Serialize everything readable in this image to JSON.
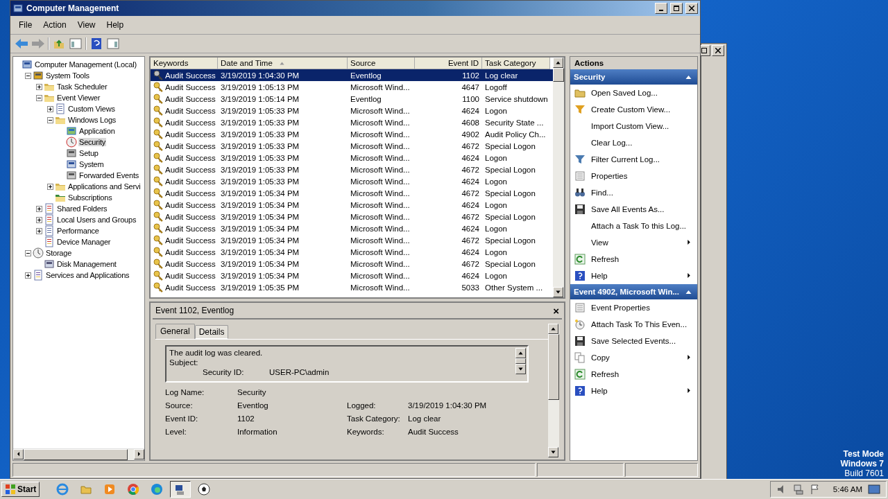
{
  "window": {
    "title": "Computer Management"
  },
  "menu": [
    "File",
    "Action",
    "View",
    "Help"
  ],
  "tree": [
    {
      "label": "Computer Management (Local)",
      "selected": false,
      "children": [
        {
          "label": "System Tools",
          "expanded": true,
          "selected": false,
          "children": [
            {
              "label": "Task Scheduler",
              "expanded": false,
              "selected": false
            },
            {
              "label": "Event Viewer",
              "expanded": true,
              "selected": false,
              "children": [
                {
                  "label": "Custom Views",
                  "expanded": false,
                  "selected": false
                },
                {
                  "label": "Windows Logs",
                  "expanded": true,
                  "selected": false,
                  "children": [
                    {
                      "label": "Application",
                      "selected": false
                    },
                    {
                      "label": "Security",
                      "selected": true
                    },
                    {
                      "label": "Setup",
                      "selected": false
                    },
                    {
                      "label": "System",
                      "selected": false
                    },
                    {
                      "label": "Forwarded Events",
                      "selected": false
                    }
                  ]
                },
                {
                  "label": "Applications and Servi",
                  "expanded": false,
                  "selected": false
                },
                {
                  "label": "Subscriptions",
                  "selected": false
                }
              ]
            },
            {
              "label": "Shared Folders",
              "expanded": false,
              "selected": false
            },
            {
              "label": "Local Users and Groups",
              "expanded": false,
              "selected": false
            },
            {
              "label": "Performance",
              "expanded": false,
              "selected": false
            },
            {
              "label": "Device Manager",
              "selected": false
            }
          ]
        },
        {
          "label": "Storage",
          "expanded": true,
          "selected": false,
          "children": [
            {
              "label": "Disk Management",
              "selected": false
            }
          ]
        },
        {
          "label": "Services and Applications",
          "expanded": false,
          "selected": false
        }
      ]
    }
  ],
  "event_table": {
    "columns": [
      {
        "label": "Keywords",
        "sorted": false
      },
      {
        "label": "Date and Time",
        "sorted": true
      },
      {
        "label": "Source",
        "sorted": false
      },
      {
        "label": "Event ID",
        "sorted": false
      },
      {
        "label": "Task Category",
        "sorted": false
      }
    ],
    "rows": [
      {
        "keywords": "Audit Success",
        "date": "3/19/2019 1:04:30 PM",
        "source": "Eventlog",
        "event_id": "1102",
        "task_category": "Log clear",
        "selected": true
      },
      {
        "keywords": "Audit Success",
        "date": "3/19/2019 1:05:13 PM",
        "source": "Microsoft Wind...",
        "event_id": "4647",
        "task_category": "Logoff",
        "selected": false
      },
      {
        "keywords": "Audit Success",
        "date": "3/19/2019 1:05:14 PM",
        "source": "Eventlog",
        "event_id": "1100",
        "task_category": "Service shutdown",
        "selected": false
      },
      {
        "keywords": "Audit Success",
        "date": "3/19/2019 1:05:33 PM",
        "source": "Microsoft Wind...",
        "event_id": "4624",
        "task_category": "Logon",
        "selected": false
      },
      {
        "keywords": "Audit Success",
        "date": "3/19/2019 1:05:33 PM",
        "source": "Microsoft Wind...",
        "event_id": "4608",
        "task_category": "Security State ...",
        "selected": false
      },
      {
        "keywords": "Audit Success",
        "date": "3/19/2019 1:05:33 PM",
        "source": "Microsoft Wind...",
        "event_id": "4902",
        "task_category": "Audit Policy Ch...",
        "selected": false
      },
      {
        "keywords": "Audit Success",
        "date": "3/19/2019 1:05:33 PM",
        "source": "Microsoft Wind...",
        "event_id": "4672",
        "task_category": "Special Logon",
        "selected": false
      },
      {
        "keywords": "Audit Success",
        "date": "3/19/2019 1:05:33 PM",
        "source": "Microsoft Wind...",
        "event_id": "4624",
        "task_category": "Logon",
        "selected": false
      },
      {
        "keywords": "Audit Success",
        "date": "3/19/2019 1:05:33 PM",
        "source": "Microsoft Wind...",
        "event_id": "4672",
        "task_category": "Special Logon",
        "selected": false
      },
      {
        "keywords": "Audit Success",
        "date": "3/19/2019 1:05:33 PM",
        "source": "Microsoft Wind...",
        "event_id": "4624",
        "task_category": "Logon",
        "selected": false
      },
      {
        "keywords": "Audit Success",
        "date": "3/19/2019 1:05:34 PM",
        "source": "Microsoft Wind...",
        "event_id": "4672",
        "task_category": "Special Logon",
        "selected": false
      },
      {
        "keywords": "Audit Success",
        "date": "3/19/2019 1:05:34 PM",
        "source": "Microsoft Wind...",
        "event_id": "4624",
        "task_category": "Logon",
        "selected": false
      },
      {
        "keywords": "Audit Success",
        "date": "3/19/2019 1:05:34 PM",
        "source": "Microsoft Wind...",
        "event_id": "4672",
        "task_category": "Special Logon",
        "selected": false
      },
      {
        "keywords": "Audit Success",
        "date": "3/19/2019 1:05:34 PM",
        "source": "Microsoft Wind...",
        "event_id": "4624",
        "task_category": "Logon",
        "selected": false
      },
      {
        "keywords": "Audit Success",
        "date": "3/19/2019 1:05:34 PM",
        "source": "Microsoft Wind...",
        "event_id": "4672",
        "task_category": "Special Logon",
        "selected": false
      },
      {
        "keywords": "Audit Success",
        "date": "3/19/2019 1:05:34 PM",
        "source": "Microsoft Wind...",
        "event_id": "4624",
        "task_category": "Logon",
        "selected": false
      },
      {
        "keywords": "Audit Success",
        "date": "3/19/2019 1:05:34 PM",
        "source": "Microsoft Wind...",
        "event_id": "4672",
        "task_category": "Special Logon",
        "selected": false
      },
      {
        "keywords": "Audit Success",
        "date": "3/19/2019 1:05:34 PM",
        "source": "Microsoft Wind...",
        "event_id": "4624",
        "task_category": "Logon",
        "selected": false
      },
      {
        "keywords": "Audit Success",
        "date": "3/19/2019 1:05:35 PM",
        "source": "Microsoft Wind...",
        "event_id": "5033",
        "task_category": "Other System ...",
        "selected": false
      }
    ]
  },
  "event_detail": {
    "title": "Event 1102, Eventlog",
    "close": "×",
    "tabs": [
      {
        "label": "General",
        "selected": true
      },
      {
        "label": "Details",
        "selected": false
      }
    ],
    "message": [
      "The audit log was cleared.",
      "Subject:"
    ],
    "message_field": {
      "label": "Security ID:",
      "value": "USER-PC\\admin"
    },
    "fields": [
      {
        "label": "Log Name:",
        "value": "Security"
      },
      {
        "label": "Source:",
        "value": "Eventlog",
        "label_2": "Logged:",
        "value_2": "3/19/2019 1:04:30 PM"
      },
      {
        "label": "Event ID:",
        "value": "1102",
        "label_2": "Task Category:",
        "value_2": "Log clear"
      },
      {
        "label": "Level:",
        "value": "Information",
        "label_2": "Keywords:",
        "value_2": "Audit Success"
      }
    ]
  },
  "actions": {
    "title": "Actions",
    "sections": [
      {
        "title": "Security",
        "expanded": true,
        "items": [
          {
            "label": "Open Saved Log...",
            "submenu": false
          },
          {
            "label": "Create Custom View...",
            "submenu": false
          },
          {
            "label": "Import Custom View...",
            "submenu": false
          },
          {
            "label": "Clear Log...",
            "submenu": false
          },
          {
            "label": "Filter Current Log...",
            "submenu": false
          },
          {
            "label": "Properties",
            "submenu": false
          },
          {
            "label": "Find...",
            "submenu": false
          },
          {
            "label": "Save All Events As...",
            "submenu": false
          },
          {
            "label": "Attach a Task To this Log...",
            "submenu": false
          },
          {
            "label": "View",
            "submenu": true
          },
          {
            "label": "Refresh",
            "submenu": false
          },
          {
            "label": "Help",
            "submenu": true
          }
        ]
      },
      {
        "title": "Event 4902, Microsoft Win...",
        "expanded": true,
        "items": [
          {
            "label": "Event Properties",
            "submenu": false
          },
          {
            "label": "Attach Task To This Even...",
            "submenu": false
          },
          {
            "label": "Save Selected Events...",
            "submenu": false
          },
          {
            "label": "Copy",
            "submenu": true
          },
          {
            "label": "Refresh",
            "submenu": false
          },
          {
            "label": "Help",
            "submenu": true
          }
        ]
      }
    ]
  },
  "desktop_notice": [
    "Test Mode",
    "Windows 7",
    "Build 7601"
  ],
  "taskbar": {
    "start": "Start",
    "clock": "5:46 AM",
    "apps": [
      {
        "selected": false
      },
      {
        "selected": false
      },
      {
        "selected": false
      },
      {
        "selected": false
      },
      {
        "selected": false
      },
      {
        "selected": true
      },
      {
        "selected": false
      }
    ]
  }
}
